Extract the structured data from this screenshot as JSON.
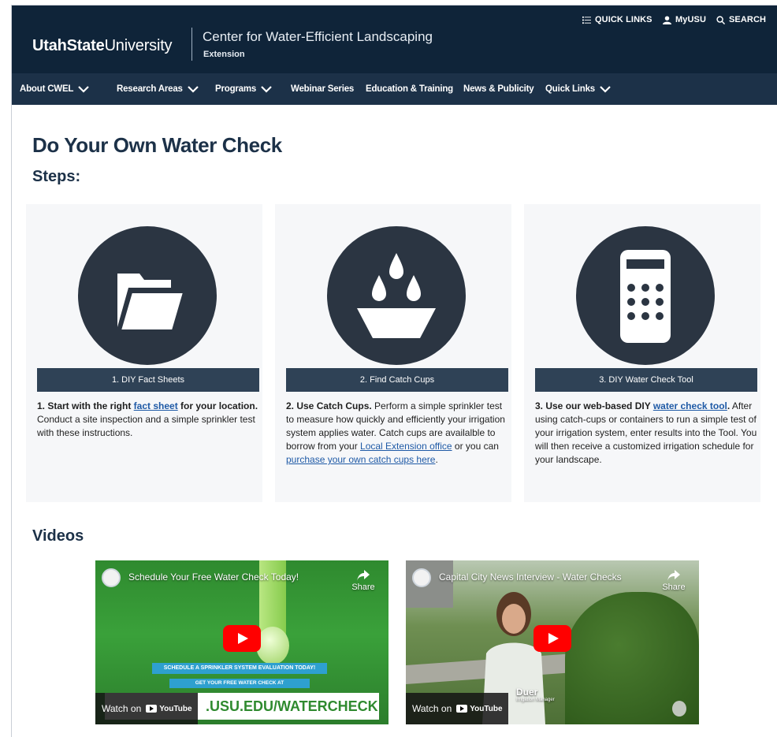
{
  "header": {
    "brand_bold": "UtahState",
    "brand_regular": "University",
    "center_name": "Center for Water-Efficient Landscaping",
    "center_sub": "Extension",
    "utility": {
      "quick_links": "QUICK LINKS",
      "myusu": "MyUSU",
      "search": "SEARCH"
    }
  },
  "nav": {
    "items": [
      {
        "label": "About CWEL",
        "dropdown": true
      },
      {
        "label": "Research Areas",
        "dropdown": true
      },
      {
        "label": "Programs",
        "dropdown": true
      },
      {
        "label": "Webinar Series",
        "dropdown": false
      },
      {
        "label": "Education & Training",
        "dropdown": false
      },
      {
        "label": "News & Publicity",
        "dropdown": false
      },
      {
        "label": "Quick Links",
        "dropdown": true
      }
    ]
  },
  "main": {
    "title": "Do Your Own Water Check",
    "steps_heading": "Steps:",
    "videos_heading": "Videos",
    "steps": [
      {
        "button": "1. DIY Fact Sheets",
        "icon": "folder-icon",
        "desc_bold1": "1. Start with the right ",
        "desc_link": "fact sheet",
        "desc_bold2": " for your location.",
        "desc_rest": " Conduct a site inspection and a simple sprinkler test with these instructions."
      },
      {
        "button": "2. Find Catch Cups",
        "icon": "catch-cup-icon",
        "desc_bold1": "2. Use Catch Cups.",
        "desc_rest1": " Perform a simple sprinkler test to measure how quickly and efficiently your irrigation system applies water. Catch cups are availalble to borrow from your ",
        "desc_link1": "Local Extension office",
        "desc_rest2": " or you can ",
        "desc_link2": "purchase your own catch cups here",
        "desc_end": "."
      },
      {
        "button": "3. DIY Water Check Tool",
        "icon": "calculator-icon",
        "desc_bold1": "3. Use our web-based DIY ",
        "desc_link": "water check tool",
        "desc_bold2": ".",
        "desc_rest": " After using catch-cups or containers to run a simple test of your irrigation system, enter results into the Tool. You will then receive a customized irrigation schedule for your landscape."
      }
    ],
    "videos": [
      {
        "title": "Schedule Your Free Water Check Today!",
        "share": "Share",
        "watch_on": "Watch on",
        "youtube": "YouTube",
        "banner1": "SCHEDULE A SPRINKLER SYSTEM EVALUATION TODAY!",
        "banner2": "GET YOUR FREE WATER CHECK AT",
        "url_text": ".USU.EDU/WATERCHECK"
      },
      {
        "title": "Capital City News Interview - Water Checks",
        "share": "Share",
        "watch_on": "Watch on",
        "youtube": "YouTube",
        "lower_third_name": "Duer",
        "lower_third_role": "Irrigation Manager"
      }
    ]
  },
  "colors": {
    "header_bg": "#0f2439",
    "nav_bg": "#1c3148",
    "step_button_bg": "#2f4256",
    "icon_circle": "#2b3542",
    "link": "#1f5aa6",
    "youtube_red": "#ff0000"
  }
}
